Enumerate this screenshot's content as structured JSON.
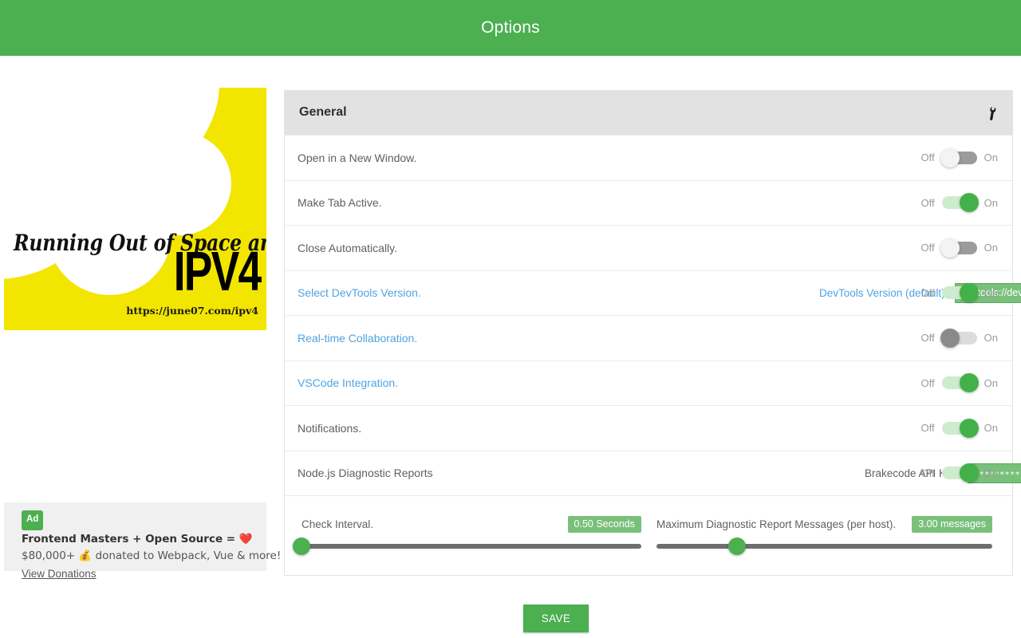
{
  "header": {
    "title": "Options",
    "bg_color": "#4CAF50"
  },
  "ad_banner": {
    "headline": "Running Out of Space and Need",
    "big_text": "IPV4",
    "url": "https://june07.com/ipv4",
    "bg_color": "#F2E500"
  },
  "ad_text": {
    "badge": "Ad",
    "line1": "Frontend Masters + Open Source = ❤️",
    "line2": "$80,000+ 💰 donated to Webpack, Vue & more!",
    "link": "View Donations"
  },
  "panel": {
    "title": "General",
    "wrench_icon": "wrench-icon",
    "toggle_off_label": "Off",
    "toggle_on_label": "On",
    "rows": [
      {
        "label": "Open in a New Window.",
        "is_link": false,
        "state": "off"
      },
      {
        "label": "Make Tab Active.",
        "is_link": false,
        "state": "on"
      },
      {
        "label": "Close Automatically.",
        "is_link": false,
        "state": "off"
      },
      {
        "label": "Select DevTools Version.",
        "is_link": true,
        "state": "on",
        "mid_label": "DevTools Version (default):",
        "mid_label_link": true,
        "mid_value": "devtools://devtools/bundled/inspector.html"
      },
      {
        "label": "Real-time Collaboration.",
        "is_link": true,
        "state": "grey"
      },
      {
        "label": "VSCode Integration.",
        "is_link": true,
        "state": "on"
      },
      {
        "label": "Notifications.",
        "is_link": false,
        "state": "on"
      },
      {
        "label": "Node.js Diagnostic Reports",
        "is_link": false,
        "state": "on",
        "mid_label": "Brakecode API Key:",
        "mid_label_link": false,
        "mid_value": "************************************"
      }
    ],
    "sliders": [
      {
        "label": "Check Interval.",
        "value_text": "0.50 Seconds",
        "percent": 0
      },
      {
        "label": "Maximum Diagnostic Report Messages (per host).",
        "value_text": "3.00 messages",
        "percent": 24
      }
    ]
  },
  "save_button": {
    "label": "SAVE"
  }
}
